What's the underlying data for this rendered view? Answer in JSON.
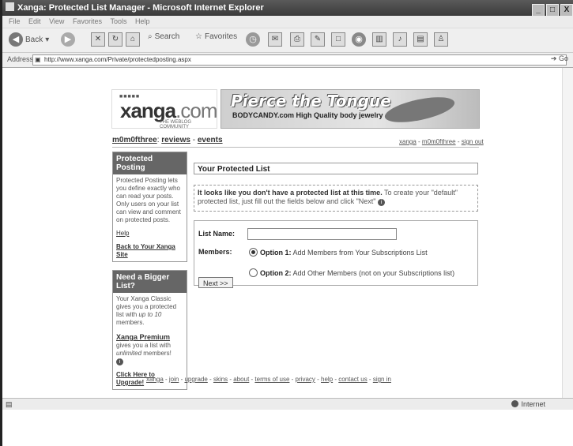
{
  "window": {
    "title": "Xanga: Protected List Manager - Microsoft Internet Explorer",
    "buttons": [
      "_",
      "□",
      "X"
    ]
  },
  "menubar": [
    "File",
    "Edit",
    "View",
    "Favorites",
    "Tools",
    "Help"
  ],
  "toolbar": {
    "back_label": "Back",
    "search_label": "Search",
    "favorites_label": "Favorites"
  },
  "address": {
    "label": "Address",
    "url": "http://www.xanga.com/Private/protectedposting.aspx",
    "go_label": "Go"
  },
  "logo": {
    "dots": "■■■■■",
    "brand": "xanga",
    "suffix": ".com",
    "tagline": "THE WEBLOG COMMUNITY"
  },
  "ad": {
    "title": "Pierce the Tongue",
    "subtitle": "BODYCANDY.com High Quality body jewelry"
  },
  "userline": {
    "user": "m0m0fthree",
    "sep1": ": ",
    "reviews": "reviews",
    "sep2": " - ",
    "events": "events"
  },
  "toplinks": {
    "xanga": "xanga",
    "user": "m0m0fthree",
    "signout": "sign out"
  },
  "sidebar": {
    "protected": {
      "title": "Protected Posting",
      "text": "Protected Posting lets you define exactly who can read your posts. Only users on your list can view and comment on protected posts.",
      "help": "Help",
      "back": "Back to Your Xanga Site"
    },
    "bigger": {
      "title": "Need a Bigger List?",
      "text1": "Your Xanga Classic gives you a protected list with ",
      "limit": "up to 10",
      "text2": " members.",
      "premium": "Xanga Premium",
      "text3": " gives you a list with ",
      "unlimited": "unlimited",
      "text4": " members!",
      "upgrade": "Click Here to Upgrade!"
    }
  },
  "main": {
    "heading": "Your Protected List",
    "notice_bold": "It looks like you don't have a protected list at this time.",
    "notice_rest": " To create your \"default\" protected list, just fill out the fields below and click \"Next\"",
    "list_name_label": "List Name:",
    "members_label": "Members:",
    "option1_bold": "Option 1:",
    "option1_text": " Add Members from Your Subscriptions List",
    "option2_bold": "Option 2:",
    "option2_text": " Add Other Members (not on your Subscriptions list)",
    "next_button": "Next >>"
  },
  "footer": [
    "xanga",
    "join",
    "upgrade",
    "skins",
    "about",
    "terms of use",
    "privacy",
    "help",
    "contact us",
    "sign in"
  ],
  "status": {
    "zone": "Internet"
  }
}
